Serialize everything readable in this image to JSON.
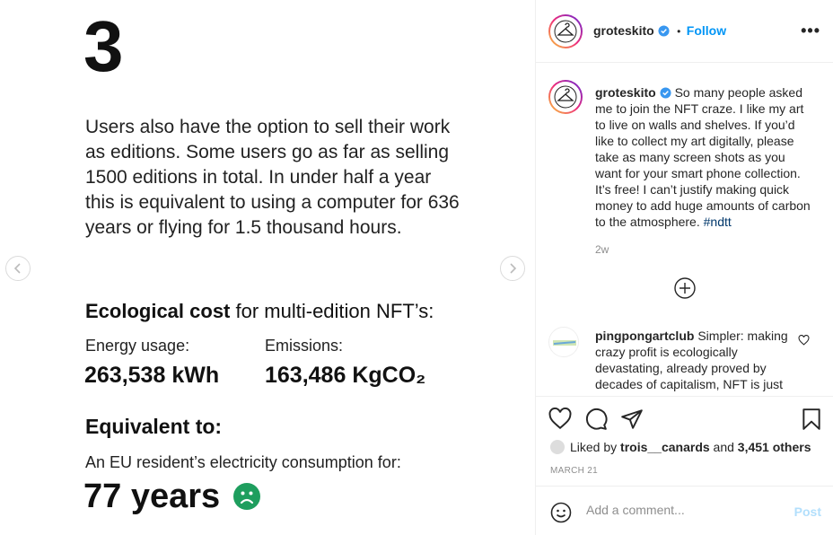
{
  "slide": {
    "number": "3",
    "paragraph": "Users also have the option to sell their work as editions. Some users go as far as selling 1500 editions in total. In under half a year this is equivalent to using a computer for 636 years or flying for 1.5 thousand hours.",
    "section_bold": "Ecological cost",
    "section_rest": " for multi-edition NFT’s:",
    "energy_label": "Energy usage:",
    "energy_value": "263,538 kWh",
    "emissions_label": "Emissions:",
    "emissions_value": "163,486 KgCO₂",
    "equiv_title": "Equivalent to:",
    "equiv_sub": "An EU resident’s electricity consumption for:",
    "equiv_value": "77 years",
    "sad_face_color": "#1e9e5e"
  },
  "header": {
    "username": "groteskito",
    "follow_label": "Follow",
    "separator": "•",
    "more_label": "•••"
  },
  "caption": {
    "username": "groteskito",
    "text": " So many people asked me to join the NFT craze. I like my art to live on walls and shelves. If you’d like to collect my art digitally, please take as many screen shots as you want for your smart phone collection. It’s free! I can’t justify making quick money to add huge amounts of carbon to the atmosphere. ",
    "hashtag": "#ndtt",
    "time": "2w"
  },
  "comment": {
    "username": "pingpongartclub",
    "text": " Simpler: making crazy profit is ecologically devastating, already proved by decades of capitalism, NFT is just"
  },
  "likes": {
    "prefix": "Liked by ",
    "user": "trois__canards",
    "middle": " and ",
    "count": "3,451 others"
  },
  "date": "MARCH 21",
  "add_comment": {
    "placeholder": "Add a comment...",
    "post_label": "Post"
  },
  "colors": {
    "accent": "#0095f6",
    "verified": "#3897f0"
  }
}
